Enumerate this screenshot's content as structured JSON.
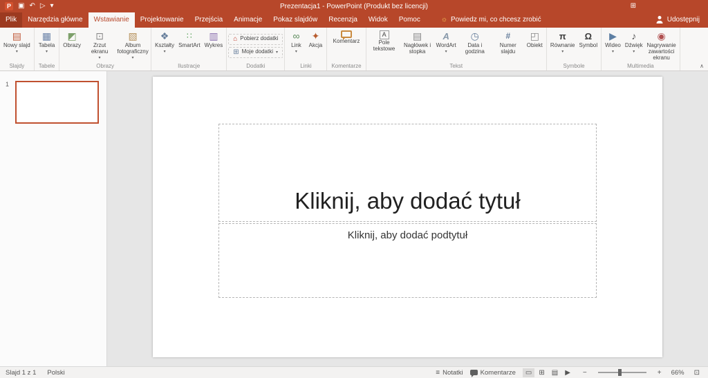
{
  "colors": {
    "accent": "#b7472a",
    "ribbon_bg": "#f8f7f6",
    "file_tab_bg": "#9c3a20"
  },
  "titlebar": {
    "title": "Prezentacja1 - PowerPoint (Produkt bez licencji)"
  },
  "menubar": {
    "tabs": [
      {
        "label": "Plik",
        "active": false,
        "file": true
      },
      {
        "label": "Narzędzia główne",
        "active": false
      },
      {
        "label": "Wstawianie",
        "active": true
      },
      {
        "label": "Projektowanie",
        "active": false
      },
      {
        "label": "Przejścia",
        "active": false
      },
      {
        "label": "Animacje",
        "active": false
      },
      {
        "label": "Pokaz slajdów",
        "active": false
      },
      {
        "label": "Recenzja",
        "active": false
      },
      {
        "label": "Widok",
        "active": false
      },
      {
        "label": "Pomoc",
        "active": false
      }
    ],
    "tell_me": "Powiedz mi, co chcesz zrobić",
    "share_label": "Udostępnij"
  },
  "ribbon": {
    "groups": [
      {
        "label": "Slajdy",
        "buttons": [
          {
            "label": "Nowy slajd",
            "icon": "new-slide",
            "arrow": true
          }
        ]
      },
      {
        "label": "Tabele",
        "buttons": [
          {
            "label": "Tabela",
            "icon": "table",
            "arrow": true
          }
        ]
      },
      {
        "label": "Obrazy",
        "buttons": [
          {
            "label": "Obrazy",
            "icon": "pictures",
            "arrow": false
          },
          {
            "label": "Zrzut ekranu",
            "icon": "screenshot",
            "arrow": true
          },
          {
            "label": "Album fotograficzny",
            "icon": "photo-album",
            "arrow": true
          }
        ]
      },
      {
        "label": "Ilustracje",
        "buttons": [
          {
            "label": "Kształty",
            "icon": "shapes",
            "arrow": true
          },
          {
            "label": "SmartArt",
            "icon": "smartart",
            "arrow": false
          },
          {
            "label": "Wykres",
            "icon": "chart",
            "arrow": false
          }
        ]
      },
      {
        "label": "Dodatki",
        "stacked": true,
        "buttons": [
          {
            "label": "Pobierz dodatki",
            "icon": "store",
            "arrow": false
          },
          {
            "label": "Moje dodatki",
            "icon": "my-addins",
            "arrow": true
          }
        ]
      },
      {
        "label": "Linki",
        "buttons": [
          {
            "label": "Link",
            "icon": "link",
            "arrow": true
          },
          {
            "label": "Akcja",
            "icon": "action",
            "arrow": false
          }
        ]
      },
      {
        "label": "Komentarze",
        "buttons": [
          {
            "label": "Komentarz",
            "icon": "comment",
            "arrow": false
          }
        ]
      },
      {
        "label": "Tekst",
        "buttons": [
          {
            "label": "Pole tekstowe",
            "icon": "text-box",
            "arrow": false
          },
          {
            "label": "Nagłówek i stopka",
            "icon": "header-footer",
            "arrow": false
          },
          {
            "label": "WordArt",
            "icon": "wordart",
            "arrow": true
          },
          {
            "label": "Data i godzina",
            "icon": "date-time",
            "arrow": false
          },
          {
            "label": "Numer slajdu",
            "icon": "slide-number",
            "arrow": false
          },
          {
            "label": "Obiekt",
            "icon": "object",
            "arrow": false
          }
        ]
      },
      {
        "label": "Symbole",
        "buttons": [
          {
            "label": "Równanie",
            "icon": "equation",
            "arrow": true
          },
          {
            "label": "Symbol",
            "icon": "symbol",
            "arrow": false
          }
        ]
      },
      {
        "label": "Multimedia",
        "buttons": [
          {
            "label": "Wideo",
            "icon": "video",
            "arrow": true
          },
          {
            "label": "Dźwięk",
            "icon": "audio",
            "arrow": true
          },
          {
            "label": "Nagrywanie zawartości ekranu",
            "icon": "screen-recording",
            "arrow": false
          }
        ]
      }
    ]
  },
  "slides_panel": {
    "slide_number": "1"
  },
  "slide": {
    "title_placeholder": "Kliknij, aby dodać tytuł",
    "subtitle_placeholder": "Kliknij, aby dodać podtytuł"
  },
  "statusbar": {
    "slide_info": "Slajd 1 z 1",
    "language": "Polski",
    "notes_label": "Notatki",
    "comments_label": "Komentarze",
    "zoom_percent": "66%"
  },
  "icons": {
    "app": "P",
    "save": "▣",
    "undo": "↶",
    "slideshow": "▷",
    "customize-qat": "▾",
    "ribbon-display": "⊞",
    "tell-me": "☼",
    "dropdown": "▾",
    "collapse-ribbon": "∧",
    "new-slide": "▤",
    "table": "▦",
    "pictures": "◩",
    "screenshot": "⊡",
    "photo-album": "▧",
    "shapes": "❖",
    "smartart": "∷",
    "chart": "▥",
    "store": "⌂",
    "my-addins": "⊞",
    "link": "∞",
    "action": "✦",
    "comment": "",
    "text-box": "A",
    "header-footer": "▤",
    "wordart": "A",
    "date-time": "◷",
    "slide-number": "#",
    "object": "◰",
    "equation": "π",
    "symbol": "Ω",
    "video": "▶",
    "audio": "♪",
    "screen-recording": "◉",
    "notes": "≡",
    "normal-view": "▭",
    "slide-sorter-view": "⊞",
    "reading-view": "▤",
    "slideshow-view": "▶",
    "zoom-out": "−",
    "zoom-in": "+",
    "fit-window": "⊡"
  }
}
